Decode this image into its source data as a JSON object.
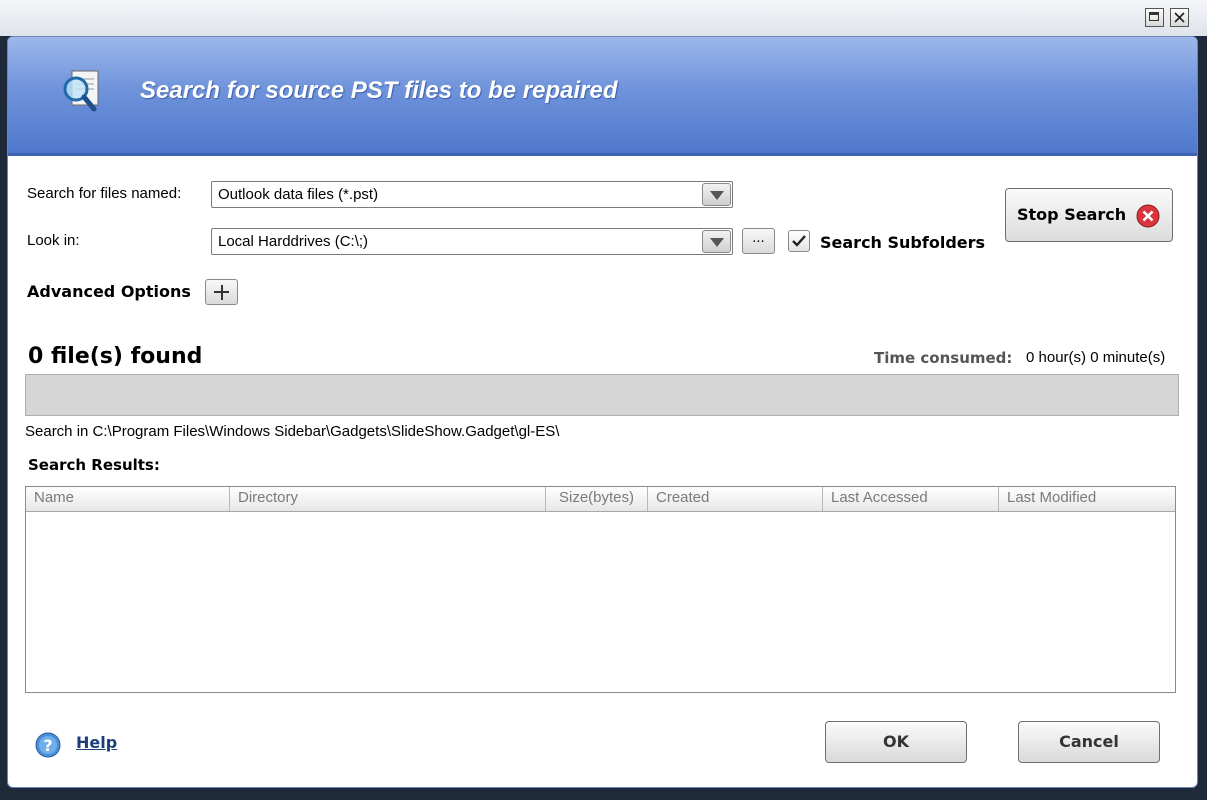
{
  "header": {
    "title": "Search for source PST files to be repaired",
    "icon": "document-search-icon"
  },
  "search_files": {
    "label": "Search for files named:",
    "value": "Outlook data files (*.pst)"
  },
  "look_in": {
    "label": "Look in:",
    "value": "Local Harddrives (C:\\;)",
    "browse_label": "..."
  },
  "subfolders": {
    "label": "Search Subfolders",
    "checked": true
  },
  "stop_button": {
    "label": "Stop Search"
  },
  "advanced": {
    "label": "Advanced Options"
  },
  "status": {
    "files_found": "0 file(s) found",
    "time_label": "Time consumed:",
    "time_value": "0 hour(s) 0 minute(s)",
    "progress": 0,
    "search_in": "Search in C:\\Program Files\\Windows Sidebar\\Gadgets\\SlideShow.Gadget\\gl-ES\\"
  },
  "results": {
    "label": "Search Results:",
    "columns": [
      "Name",
      "Directory",
      "Size(bytes)",
      "Created",
      "Last Accessed",
      "Last Modified"
    ],
    "rows": []
  },
  "footer": {
    "help_label": "Help",
    "ok_label": "OK",
    "cancel_label": "Cancel"
  },
  "colors": {
    "header_top": "#9db7ea",
    "header_bottom": "#4f78cc",
    "progress_bg": "#d6d6d6"
  }
}
